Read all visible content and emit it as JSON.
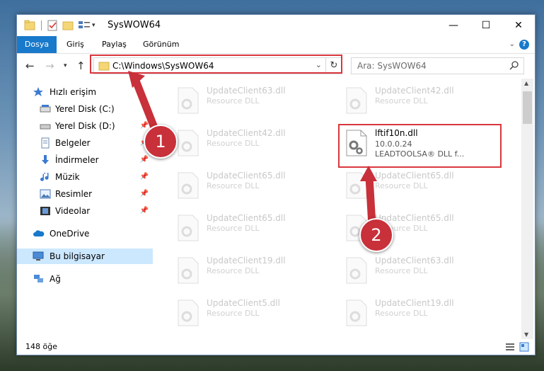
{
  "window": {
    "title": "SysWOW64",
    "minimize_symbol": "—",
    "maximize_symbol": "☐",
    "close_symbol": "✕"
  },
  "ribbon": {
    "tabs": [
      "Dosya",
      "Giriş",
      "Paylaş",
      "Görünüm"
    ],
    "help_label": "?"
  },
  "navigation": {
    "address": "C:\\Windows\\SysWOW64",
    "search_placeholder": "Ara: SysWOW64"
  },
  "sidebar": {
    "items": [
      {
        "label": "Hızlı erişim",
        "icon": "star-icon"
      },
      {
        "label": "Yerel Disk (C:)",
        "icon": "drive-icon",
        "pinned": true
      },
      {
        "label": "Yerel Disk (D:)",
        "icon": "drive-icon",
        "pinned": true
      },
      {
        "label": "Belgeler",
        "icon": "documents-icon",
        "pinned": true
      },
      {
        "label": "İndirmeler",
        "icon": "download-icon",
        "pinned": true
      },
      {
        "label": "Müzik",
        "icon": "music-icon",
        "pinned": true
      },
      {
        "label": "Resimler",
        "icon": "pictures-icon",
        "pinned": true
      },
      {
        "label": "Videolar",
        "icon": "videos-icon",
        "pinned": true
      },
      {
        "label": "OneDrive",
        "icon": "cloud-icon"
      },
      {
        "label": "Bu bilgisayar",
        "icon": "computer-icon",
        "selected": true
      },
      {
        "label": "Ağ",
        "icon": "network-icon"
      }
    ]
  },
  "files": {
    "left_column": [
      {
        "name": "UpdateClient63.dll",
        "type": "Resource DLL"
      },
      {
        "name": "UpdateClient42.dll",
        "type": "Resource DLL"
      },
      {
        "name": "UpdateClient65.dll",
        "type": "Resource DLL"
      },
      {
        "name": "UpdateClient65.dll",
        "type": "Resource DLL"
      },
      {
        "name": "UpdateClient19.dll",
        "type": "Resource DLL"
      },
      {
        "name": "UpdateClient5.dll",
        "type": "Resource DLL"
      }
    ],
    "right_column": [
      {
        "name": "UpdateClient42.dll",
        "type": "Resource DLL"
      },
      {
        "name": "lftif10n.dll",
        "type": "10.0.0.24",
        "description": "LEADTOOLSA® DLL f...",
        "highlighted": true
      },
      {
        "name": "UpdateClient65.dll",
        "type": "Resource DLL"
      },
      {
        "name": "UpdateClient65.dll",
        "type": "Resource DLL"
      },
      {
        "name": "UpdateClient63.dll",
        "type": "Resource DLL"
      },
      {
        "name": "UpdateClient19.dll",
        "type": "Resource DLL"
      }
    ]
  },
  "status": {
    "item_count": "148 öğe"
  },
  "callouts": [
    {
      "number": "1"
    },
    {
      "number": "2"
    }
  ],
  "colors": {
    "accent": "#1979ca",
    "highlight": "#d9373d",
    "selected": "#cce8ff"
  }
}
